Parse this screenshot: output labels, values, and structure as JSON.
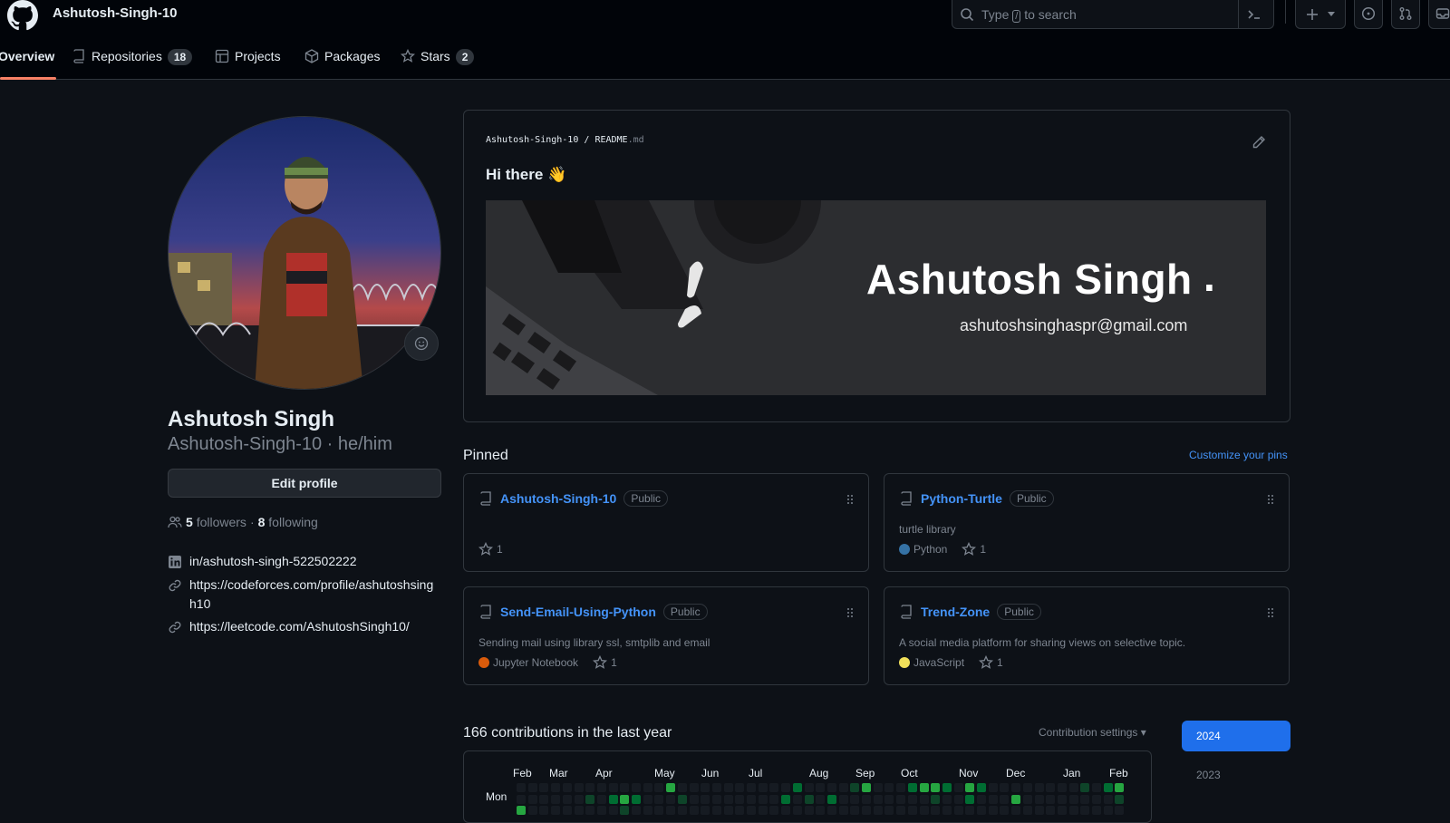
{
  "header": {
    "username": "Ashutosh-Singh-10",
    "search_placeholder_pre": "Type",
    "search_placeholder_key": "/",
    "search_placeholder_post": "to search"
  },
  "tabs": [
    {
      "label": "Overview",
      "count": null,
      "active": true
    },
    {
      "label": "Repositories",
      "count": "18"
    },
    {
      "label": "Projects",
      "count": null
    },
    {
      "label": "Packages",
      "count": null
    },
    {
      "label": "Stars",
      "count": "2"
    }
  ],
  "profile": {
    "name": "Ashutosh Singh",
    "handle": "Ashutosh-Singh-10 · he/him",
    "edit_label": "Edit profile",
    "followers_count": "5",
    "followers_label": "followers",
    "sep": "·",
    "following_count": "8",
    "following_label": "following",
    "links": [
      {
        "icon": "linkedin-icon",
        "text": "in/ashutosh-singh-522502222"
      },
      {
        "icon": "link-icon",
        "text": "https://codeforces.com/profile/ashutoshsingh10"
      },
      {
        "icon": "link-icon",
        "text": "https://leetcode.com/AshutoshSingh10/"
      }
    ]
  },
  "readme": {
    "owner": "Ashutosh-Singh-10",
    "sep": "/",
    "file": "README",
    "ext": ".md",
    "greeting": "Hi there 👋",
    "banner_name": "Ashutosh Singh",
    "banner_dot": ".",
    "banner_email": "ashutoshsinghaspr@gmail.com"
  },
  "pinned": {
    "title": "Pinned",
    "customize": "Customize your pins",
    "items": [
      {
        "name": "Ashutosh-Singh-10",
        "visibility": "Public",
        "description": "",
        "language": "",
        "lang_color": "",
        "stars": "1"
      },
      {
        "name": "Python-Turtle",
        "visibility": "Public",
        "description": "turtle library",
        "language": "Python",
        "lang_color": "#3572A5",
        "stars": "1"
      },
      {
        "name": "Send-Email-Using-Python",
        "visibility": "Public",
        "description": "Sending mail using library ssl, smtplib and email",
        "language": "Jupyter Notebook",
        "lang_color": "#DA5B0B",
        "stars": "1"
      },
      {
        "name": "Trend-Zone",
        "visibility": "Public",
        "description": "A social media platform for sharing views on selective topic.",
        "language": "JavaScript",
        "lang_color": "#f1e05a",
        "stars": "1"
      }
    ]
  },
  "contributions": {
    "title": "166 contributions in the last year",
    "settings": "Contribution settings ▾",
    "months": [
      "Feb",
      "Mar",
      "Apr",
      "May",
      "Jun",
      "Jul",
      "Aug",
      "Sep",
      "Oct",
      "Nov",
      "Dec",
      "Jan",
      "Feb"
    ],
    "day_label": "Mon",
    "years": [
      "2024",
      "2023"
    ]
  },
  "colors": {
    "accent": "#4493f8",
    "bg": "#0d1117",
    "year_active": "#1f6feb",
    "contrib_levels": [
      "#161b22",
      "#0e4429",
      "#006d32",
      "#26a641"
    ]
  }
}
